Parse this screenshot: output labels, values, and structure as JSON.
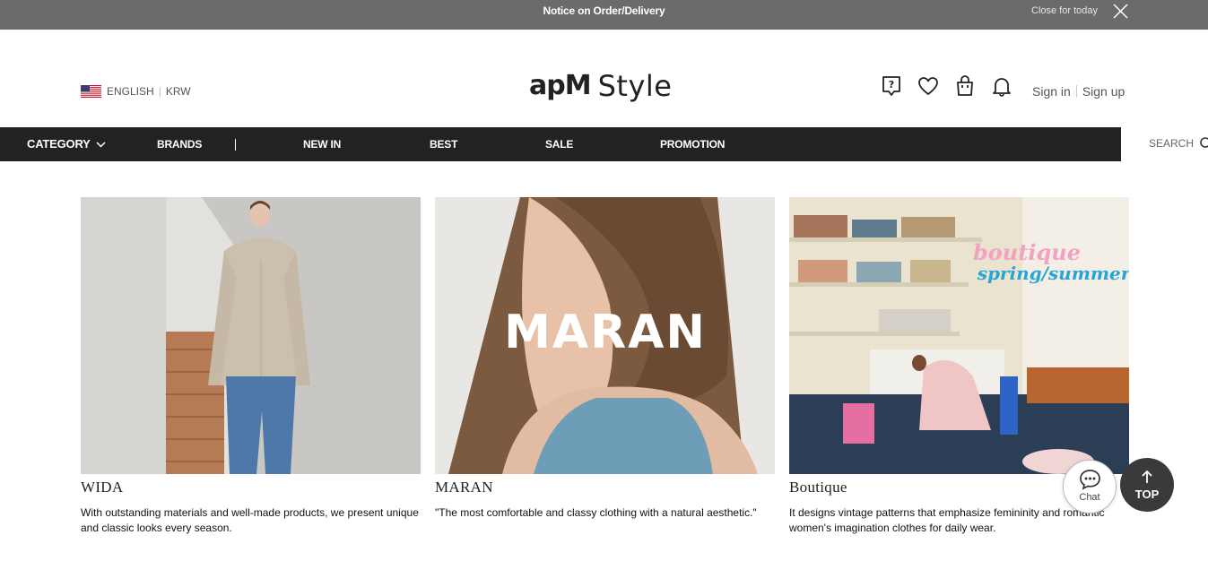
{
  "notice": {
    "text": "Notice on Order/Delivery",
    "close_text": "Close for today"
  },
  "header": {
    "language": "ENGLISH",
    "currency": "KRW",
    "logo_apm": "apM",
    "logo_style": "Style",
    "sign_in": "Sign in",
    "sign_up": "Sign up",
    "icons": [
      "question-icon",
      "heart-icon",
      "shopping-bag-icon",
      "bell-icon"
    ]
  },
  "nav": {
    "items": [
      "CATEGORY",
      "BRANDS",
      "NEW IN",
      "BEST",
      "SALE",
      "PROMOTION"
    ],
    "search_label": "SEARCH"
  },
  "brands": [
    {
      "name": "WIDA",
      "description": "With outstanding materials and well-made products, we present unique and classic looks every season."
    },
    {
      "name": "MARAN",
      "overlay_text": "MARAN",
      "description": "\"The most comfortable and classy clothing with a natural aesthetic.\""
    },
    {
      "name": "Boutique",
      "overlay_line1": "boutique",
      "overlay_line2": "spring/summer",
      "description": "It designs vintage patterns that emphasize femininity and romantic women's imagination clothes for daily wear."
    }
  ],
  "floating": {
    "chat_label": "Chat",
    "top_label": "TOP"
  },
  "colors": {
    "notice_bg": "#6b6b6b",
    "nav_bg": "#222222",
    "top_btn_bg": "#3a3a3a"
  }
}
